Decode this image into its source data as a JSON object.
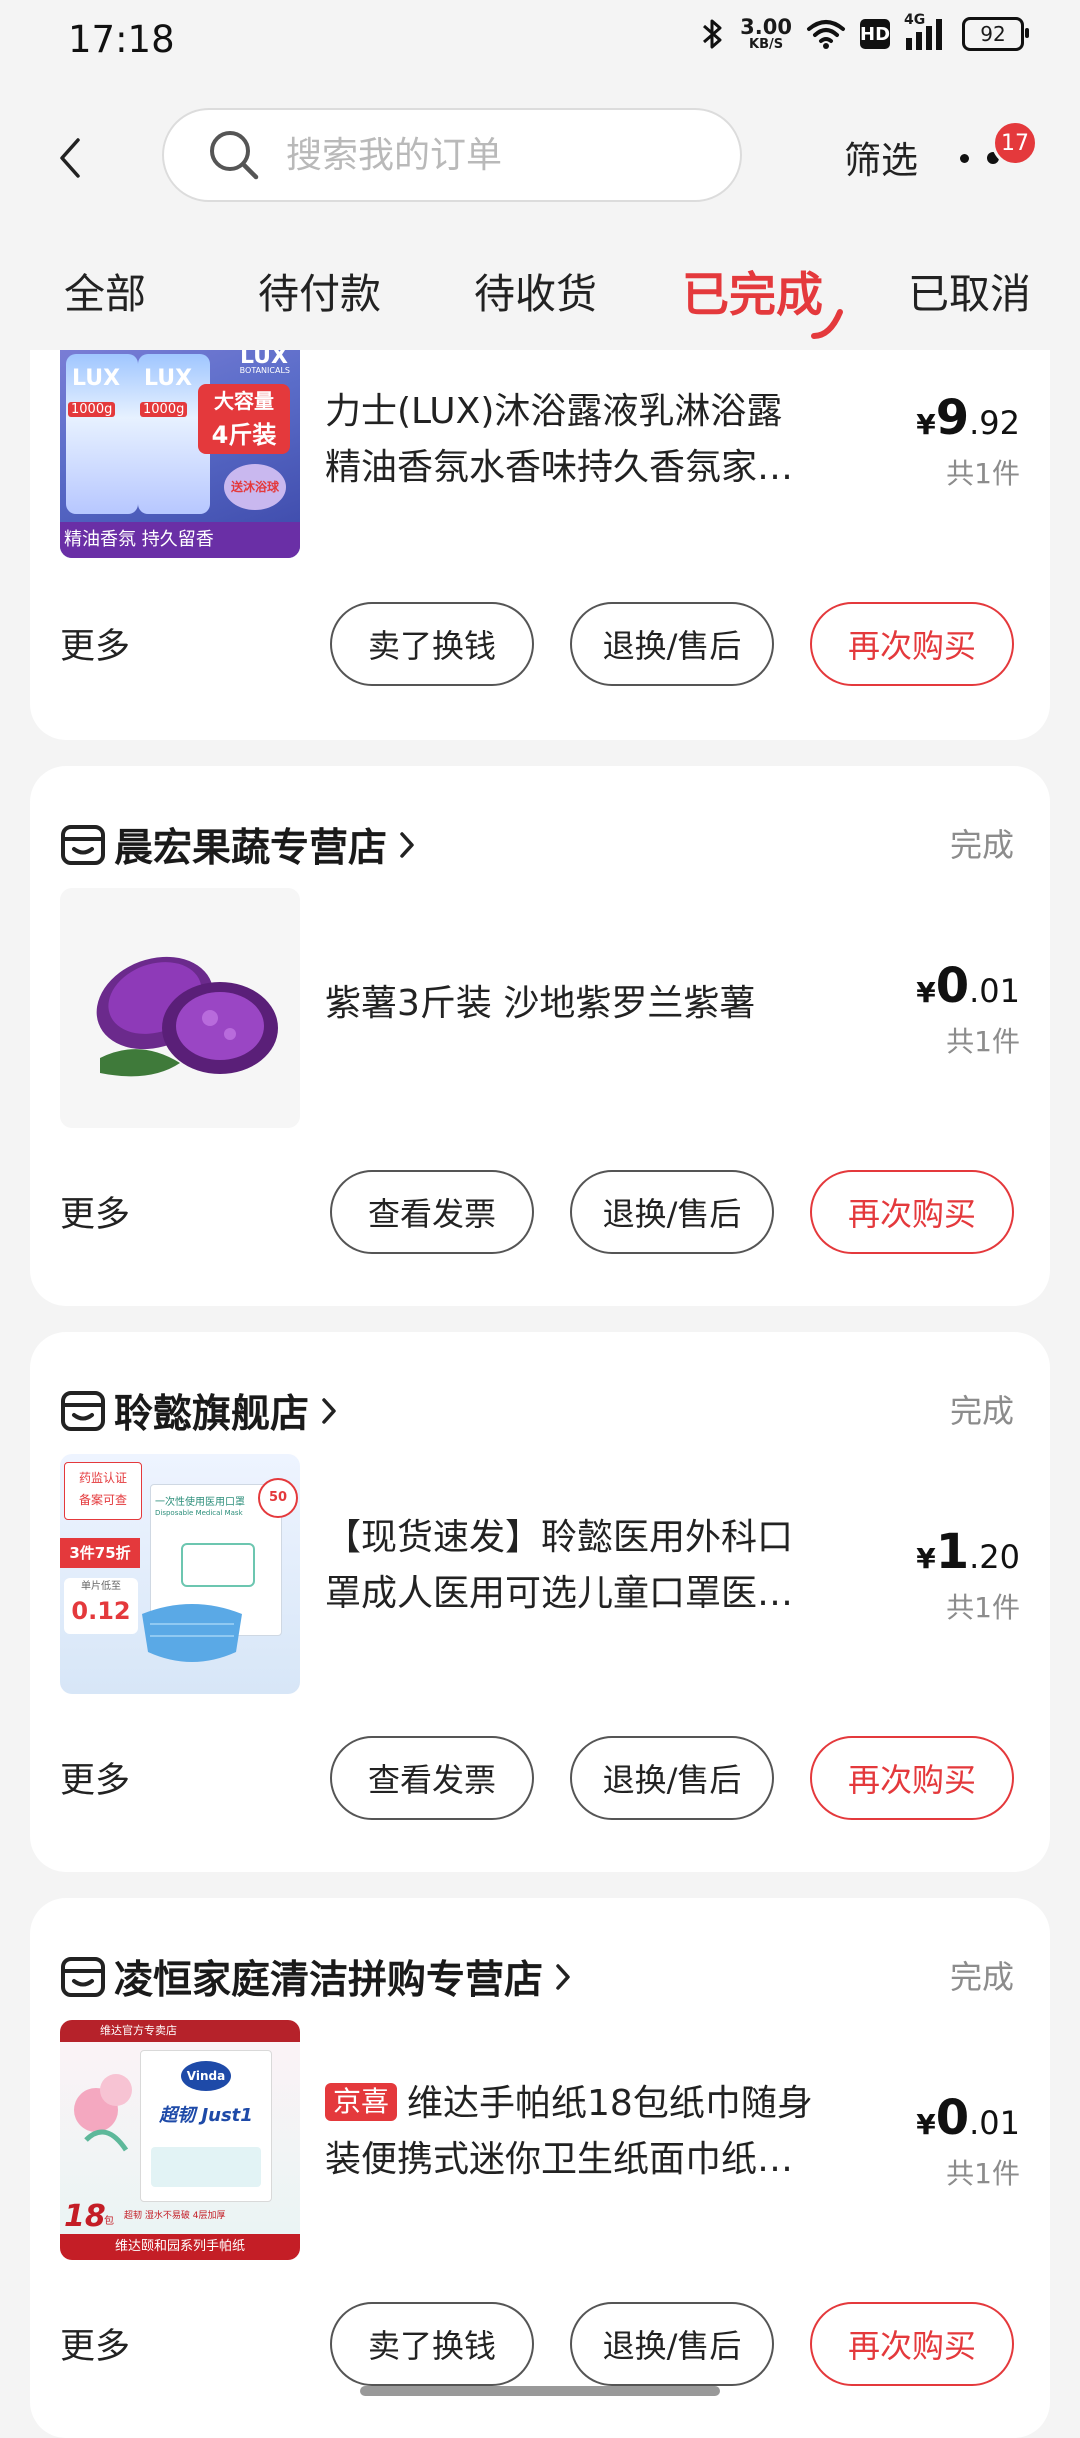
{
  "status_bar": {
    "time": "17:18",
    "net_speed_value": "3.00",
    "net_speed_unit": "KB/S",
    "hd_label": "HD",
    "net_type": "4G",
    "battery": "92"
  },
  "header": {
    "search_placeholder": "搜索我的订单",
    "filter_label": "筛选",
    "more_badge_count": "17"
  },
  "tabs": [
    {
      "label": "全部",
      "active": false
    },
    {
      "label": "待付款",
      "active": false
    },
    {
      "label": "待收货",
      "active": false
    },
    {
      "label": "已完成",
      "active": true
    },
    {
      "label": "已取消",
      "active": false
    }
  ],
  "orders": [
    {
      "shop_name": "",
      "status": "",
      "image_texts": {
        "brand": "LUX",
        "brand_sub": "BOTANICALS",
        "volume": "1000g",
        "tag_line1": "大容量",
        "tag_line2": "4斤装",
        "gift": "送沐浴球",
        "strip": "精油香氛 持久留香"
      },
      "title_line1": "力士(LUX)沐浴露液乳淋浴露",
      "title_line2": "精油香氛水香味持久香氛家…",
      "price_int": "9",
      "price_dec": ".92",
      "quantity": "共1件",
      "more_label": "更多",
      "buttons": [
        "卖了换钱",
        "退换/售后",
        "再次购买"
      ]
    },
    {
      "shop_name": "晨宏果蔬专营店",
      "status": "完成",
      "title_line1": "紫薯3斤装 沙地紫罗兰紫薯",
      "title_line2": "",
      "price_int": "0",
      "price_dec": ".01",
      "quantity": "共1件",
      "more_label": "更多",
      "buttons": [
        "查看发票",
        "退换/售后",
        "再次购买"
      ]
    },
    {
      "shop_name": "聆懿旗舰店",
      "status": "完成",
      "image_texts": {
        "cert_line1": "药监认证",
        "cert_line2": "备案可查",
        "discount": "3件75折",
        "unit_label": "单片低至",
        "unit_price": "0.12",
        "pack_label": "一次性使用医用口罩",
        "pack_sub": "Disposable Medical Mask",
        "count_badge": "50"
      },
      "title_line1": "【现货速发】聆懿医用外科口",
      "title_line2": "罩成人医用可选儿童口罩医…",
      "price_int": "1",
      "price_dec": ".20",
      "quantity": "共1件",
      "more_label": "更多",
      "buttons": [
        "查看发票",
        "退换/售后",
        "再次购买"
      ]
    },
    {
      "shop_name": "凌恒家庭清洁拼购专营店",
      "status": "完成",
      "image_texts": {
        "top_label": "维达官方专卖店",
        "brand": "Vinda",
        "product": "超韧 Just1",
        "count": "18",
        "count_unit": "包",
        "feature": "超韧 湿水不易破 4层加厚",
        "strip": "维达颐和园系列手帕纸"
      },
      "tag": "京喜",
      "title_line1": "维达手帕纸18包纸巾随身",
      "title_line2": "装便携式迷你卫生纸面巾纸…",
      "price_int": "0",
      "price_dec": ".01",
      "quantity": "共1件",
      "more_label": "更多",
      "buttons": [
        "卖了换钱",
        "退换/售后",
        "再次购买"
      ]
    }
  ],
  "currency_symbol": "¥",
  "colors": {
    "accent": "#e4393c",
    "muted": "#8c8c8c",
    "background": "#f4f4f4"
  }
}
